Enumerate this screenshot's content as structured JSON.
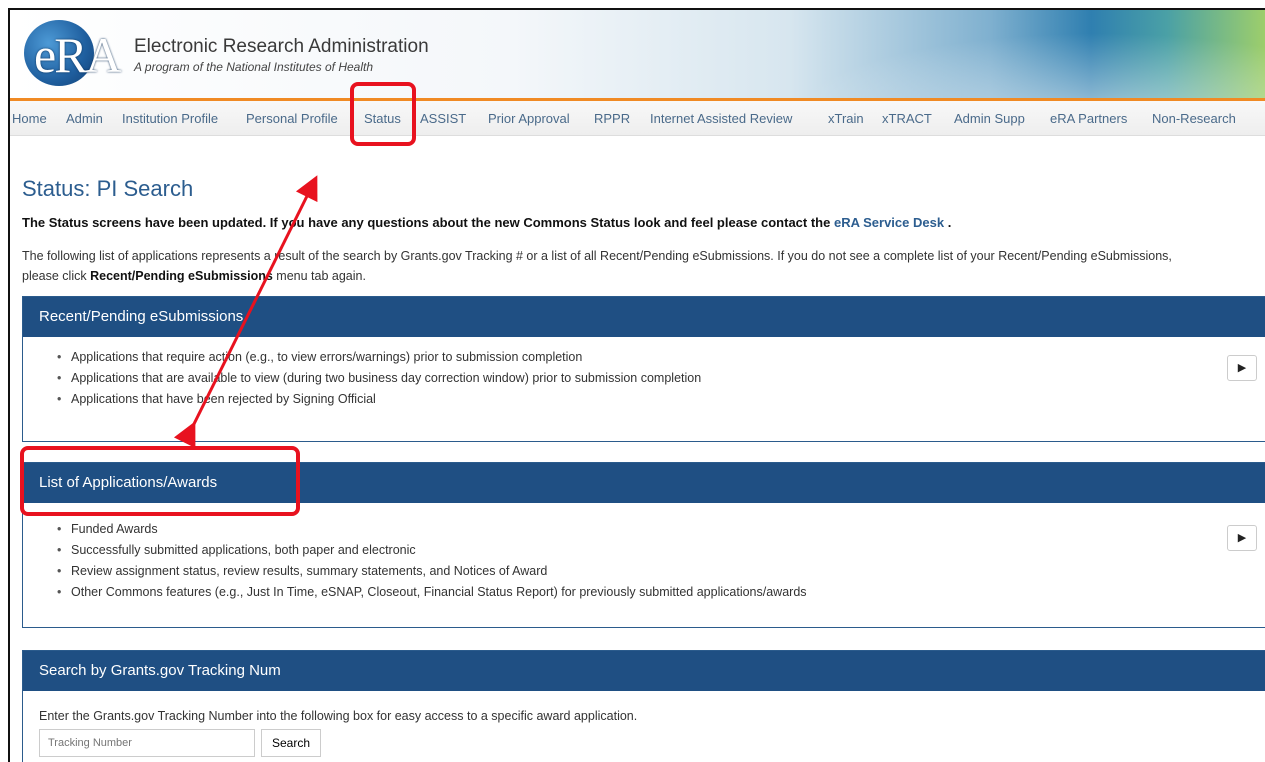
{
  "brand": {
    "logo_text": "eRA",
    "title": "Electronic Research Administration",
    "subtitle": "A program of the National Institutes of Health"
  },
  "nav": {
    "items": [
      "Home",
      "Admin",
      "Institution Profile",
      "Personal Profile",
      "Status",
      "ASSIST",
      "Prior Approval",
      "RPPR",
      "Internet Assisted Review",
      "xTrain",
      "xTRACT",
      "Admin Supp",
      "eRA Partners",
      "Non-Research"
    ],
    "active": "Status"
  },
  "page": {
    "title": "Status: PI Search",
    "notice_prefix": "The Status screens have been updated. If you have any questions about the new Commons Status look and feel please contact the",
    "notice_link": "eRA Service Desk",
    "notice_suffix": ".",
    "intro_1": "The following list of applications represents a result of the search by Grants.gov Tracking # or a list of all Recent/Pending eSubmissions. If you do not see a complete list of your Recent/Pending eSubmissions, please click",
    "intro_bold": "Recent/Pending eSubmissions",
    "intro_2": "menu tab again."
  },
  "panels": {
    "recent": {
      "title": "Recent/Pending eSubmissions",
      "items": [
        "Applications that require action (e.g., to view errors/warnings) prior to submission completion",
        "Applications that are available to view (during two business day correction window) prior to submission completion",
        "Applications that have been rejected by Signing Official"
      ],
      "button": "▶"
    },
    "list": {
      "title": "List of Applications/Awards",
      "items": [
        "Funded Awards",
        "Successfully submitted applications, both paper and electronic",
        "Review assignment status, review results, summary statements, and Notices of Award",
        "Other Commons features (e.g., Just In Time, eSNAP, Closeout, Financial Status Report) for previously submitted applications/awards"
      ],
      "button": "▶"
    },
    "search": {
      "title": "Search by Grants.gov Tracking Num",
      "instruction": "Enter the Grants.gov Tracking Number into the following box for easy access to a specific award application.",
      "placeholder": "Tracking Number",
      "button": "Search"
    }
  },
  "annotation": {
    "color": "#e8121f"
  }
}
